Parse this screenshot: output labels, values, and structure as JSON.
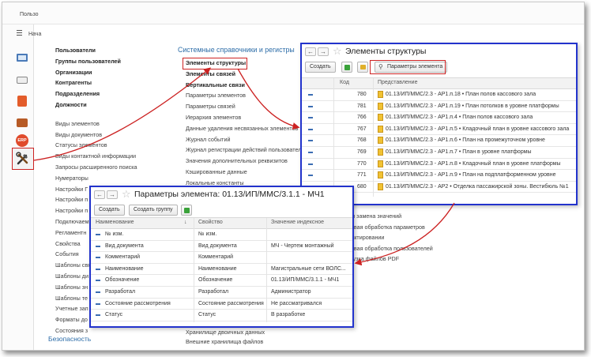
{
  "app": {
    "title": "Пользо",
    "nav_tab": "Нача"
  },
  "colors": {
    "accent_blue": "#2d6da8",
    "highlight_red": "#cc2222",
    "window_border": "#2233cc"
  },
  "icons": [
    "desktop-icon",
    "tray-icon",
    "calculator-icon",
    "briefcase-icon",
    "erp-icon",
    "tools-icon"
  ],
  "left_column_bold": [
    "Пользователи",
    "Группы пользователей",
    "Организации",
    "Контрагенты",
    "Подразделения",
    "Должности"
  ],
  "left_column_items": [
    "Виды элементов",
    "Виды документов",
    "Статусы элементов",
    "Виды контактной информации",
    "Запросы расширенного поиска",
    "Нумераторы",
    "Настройки Г",
    "Настройки п",
    "Настройки п",
    "Подключаем",
    "Регламентн",
    "Свойства",
    "События",
    "Шаблоны свя",
    "Шаблоны ди",
    "Шаблоны зн",
    "Шаблоны те",
    "Учетные зап",
    "Форматы до",
    "Состояния з"
  ],
  "section_title": "Системные справочники и регистры",
  "middle_column_items": [
    "Элементы структуры",
    "Элементы связей",
    "Вертикальные связи",
    "Параметры элементов",
    "Параметры связей",
    "Иерархия элементов",
    "Данные удаления несвязанных элементов",
    "Журнал событий",
    "Журнал регистрации действий пользователей",
    "Значения дополнительных реквизитов",
    "Кэшированные данные",
    "Локальные константы"
  ],
  "middle_column_bottom": [
    "Хранилище двоичных данных",
    "Внешние хранилища файлов"
  ],
  "right_partial_items": [
    "к и замена значений",
    "повая обработка параметров",
    "дактировании",
    "повая обработка пользователей",
    "грузка файлов PDF"
  ],
  "security_link": "Безопасность",
  "structure_window": {
    "title": "Элементы структуры",
    "create_button": "Создать",
    "params_button": "Параметры элемента",
    "columns": {
      "code": "Код",
      "presentation": "Представление"
    },
    "rows": [
      {
        "code": "780",
        "text": "01.13/ИП/ММС/2.3 - АР1.п.18 • План полов кассового зала"
      },
      {
        "code": "781",
        "text": "01.13/ИП/ММС/2.3 - АР1.п.19 • План потолков в уровне платформы"
      },
      {
        "code": "766",
        "text": "01.13/ИП/ММС/2.3 - АР1.п.4 • План полов кассового зала"
      },
      {
        "code": "767",
        "text": "01.13/ИП/ММС/2.3 - АР1.п.5 • Кладочный план в уровне кассового зала"
      },
      {
        "code": "768",
        "text": "01.13/ИП/ММС/2.3 - АР1.п.6 • План на промежуточном уровне"
      },
      {
        "code": "769",
        "text": "01.13/ИП/ММС/2.3 - АР1.п.7 • План в уровне платформы"
      },
      {
        "code": "770",
        "text": "01.13/ИП/ММС/2.3 - АР1.п.8 • Кладочный план в уровне платформы"
      },
      {
        "code": "771",
        "text": "01.13/ИП/ММС/2.3 - АР1.п.9 • План на подплатформенном уровне"
      },
      {
        "code": "680",
        "text": "01.13/ИП/ММС/2.3 - АР2 • Отделка пассажирской зоны. Вестибюль №1"
      }
    ]
  },
  "params_window": {
    "title": "Параметры элемента: 01.13/ИП/ММС/3.1.1 - МЧ1",
    "create_button": "Создать",
    "create_group_button": "Создать группу",
    "columns": {
      "name": "Наименование",
      "property": "Свойство",
      "value": "Значение индексное"
    },
    "sort_indicator": "↓",
    "rows": [
      {
        "name": "№ изм.",
        "property": "№ изм.",
        "value": ""
      },
      {
        "name": "Вид документа",
        "property": "Вид документа",
        "value": "МЧ - Чертеж монтажный"
      },
      {
        "name": "Комментарий",
        "property": "Комментарий",
        "value": ""
      },
      {
        "name": "Наименование",
        "property": "Наименование",
        "value": "Магистральные сети ВОЛС..."
      },
      {
        "name": "Обозначение",
        "property": "Обозначение",
        "value": "01.13/ИП/ММС/3.1.1 - МЧ1"
      },
      {
        "name": "Разработал",
        "property": "Разработал",
        "value": "Администратор"
      },
      {
        "name": "Состояние рассмотрения",
        "property": "Состояние рассмотрения",
        "value": "Не рассматривался"
      },
      {
        "name": "Статус",
        "property": "Статус",
        "value": "В разработке"
      }
    ]
  }
}
